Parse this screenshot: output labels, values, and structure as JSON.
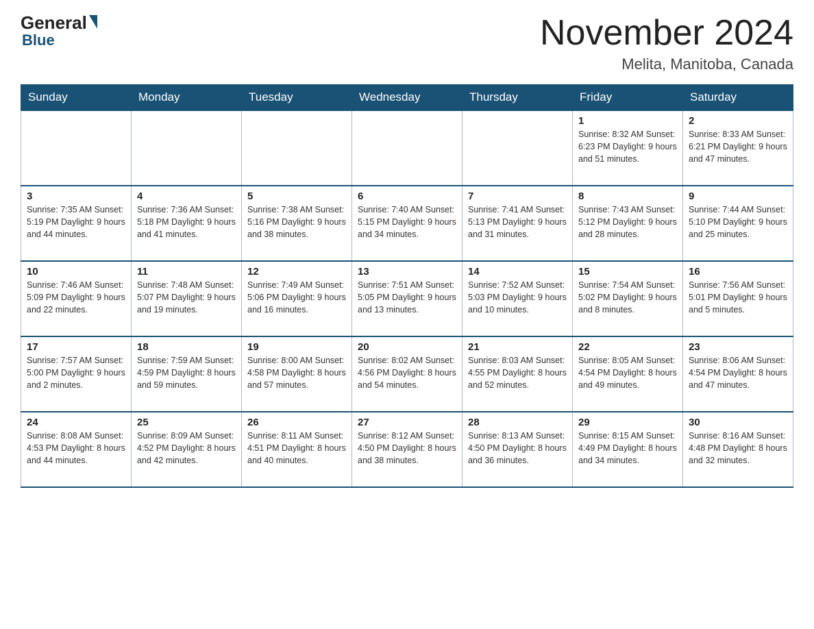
{
  "header": {
    "logo_text1": "General",
    "logo_text2": "Blue",
    "month_title": "November 2024",
    "location": "Melita, Manitoba, Canada"
  },
  "days_of_week": [
    "Sunday",
    "Monday",
    "Tuesday",
    "Wednesday",
    "Thursday",
    "Friday",
    "Saturday"
  ],
  "weeks": [
    [
      {
        "day": "",
        "info": ""
      },
      {
        "day": "",
        "info": ""
      },
      {
        "day": "",
        "info": ""
      },
      {
        "day": "",
        "info": ""
      },
      {
        "day": "",
        "info": ""
      },
      {
        "day": "1",
        "info": "Sunrise: 8:32 AM\nSunset: 6:23 PM\nDaylight: 9 hours and 51 minutes."
      },
      {
        "day": "2",
        "info": "Sunrise: 8:33 AM\nSunset: 6:21 PM\nDaylight: 9 hours and 47 minutes."
      }
    ],
    [
      {
        "day": "3",
        "info": "Sunrise: 7:35 AM\nSunset: 5:19 PM\nDaylight: 9 hours and 44 minutes."
      },
      {
        "day": "4",
        "info": "Sunrise: 7:36 AM\nSunset: 5:18 PM\nDaylight: 9 hours and 41 minutes."
      },
      {
        "day": "5",
        "info": "Sunrise: 7:38 AM\nSunset: 5:16 PM\nDaylight: 9 hours and 38 minutes."
      },
      {
        "day": "6",
        "info": "Sunrise: 7:40 AM\nSunset: 5:15 PM\nDaylight: 9 hours and 34 minutes."
      },
      {
        "day": "7",
        "info": "Sunrise: 7:41 AM\nSunset: 5:13 PM\nDaylight: 9 hours and 31 minutes."
      },
      {
        "day": "8",
        "info": "Sunrise: 7:43 AM\nSunset: 5:12 PM\nDaylight: 9 hours and 28 minutes."
      },
      {
        "day": "9",
        "info": "Sunrise: 7:44 AM\nSunset: 5:10 PM\nDaylight: 9 hours and 25 minutes."
      }
    ],
    [
      {
        "day": "10",
        "info": "Sunrise: 7:46 AM\nSunset: 5:09 PM\nDaylight: 9 hours and 22 minutes."
      },
      {
        "day": "11",
        "info": "Sunrise: 7:48 AM\nSunset: 5:07 PM\nDaylight: 9 hours and 19 minutes."
      },
      {
        "day": "12",
        "info": "Sunrise: 7:49 AM\nSunset: 5:06 PM\nDaylight: 9 hours and 16 minutes."
      },
      {
        "day": "13",
        "info": "Sunrise: 7:51 AM\nSunset: 5:05 PM\nDaylight: 9 hours and 13 minutes."
      },
      {
        "day": "14",
        "info": "Sunrise: 7:52 AM\nSunset: 5:03 PM\nDaylight: 9 hours and 10 minutes."
      },
      {
        "day": "15",
        "info": "Sunrise: 7:54 AM\nSunset: 5:02 PM\nDaylight: 9 hours and 8 minutes."
      },
      {
        "day": "16",
        "info": "Sunrise: 7:56 AM\nSunset: 5:01 PM\nDaylight: 9 hours and 5 minutes."
      }
    ],
    [
      {
        "day": "17",
        "info": "Sunrise: 7:57 AM\nSunset: 5:00 PM\nDaylight: 9 hours and 2 minutes."
      },
      {
        "day": "18",
        "info": "Sunrise: 7:59 AM\nSunset: 4:59 PM\nDaylight: 8 hours and 59 minutes."
      },
      {
        "day": "19",
        "info": "Sunrise: 8:00 AM\nSunset: 4:58 PM\nDaylight: 8 hours and 57 minutes."
      },
      {
        "day": "20",
        "info": "Sunrise: 8:02 AM\nSunset: 4:56 PM\nDaylight: 8 hours and 54 minutes."
      },
      {
        "day": "21",
        "info": "Sunrise: 8:03 AM\nSunset: 4:55 PM\nDaylight: 8 hours and 52 minutes."
      },
      {
        "day": "22",
        "info": "Sunrise: 8:05 AM\nSunset: 4:54 PM\nDaylight: 8 hours and 49 minutes."
      },
      {
        "day": "23",
        "info": "Sunrise: 8:06 AM\nSunset: 4:54 PM\nDaylight: 8 hours and 47 minutes."
      }
    ],
    [
      {
        "day": "24",
        "info": "Sunrise: 8:08 AM\nSunset: 4:53 PM\nDaylight: 8 hours and 44 minutes."
      },
      {
        "day": "25",
        "info": "Sunrise: 8:09 AM\nSunset: 4:52 PM\nDaylight: 8 hours and 42 minutes."
      },
      {
        "day": "26",
        "info": "Sunrise: 8:11 AM\nSunset: 4:51 PM\nDaylight: 8 hours and 40 minutes."
      },
      {
        "day": "27",
        "info": "Sunrise: 8:12 AM\nSunset: 4:50 PM\nDaylight: 8 hours and 38 minutes."
      },
      {
        "day": "28",
        "info": "Sunrise: 8:13 AM\nSunset: 4:50 PM\nDaylight: 8 hours and 36 minutes."
      },
      {
        "day": "29",
        "info": "Sunrise: 8:15 AM\nSunset: 4:49 PM\nDaylight: 8 hours and 34 minutes."
      },
      {
        "day": "30",
        "info": "Sunrise: 8:16 AM\nSunset: 4:48 PM\nDaylight: 8 hours and 32 minutes."
      }
    ]
  ]
}
